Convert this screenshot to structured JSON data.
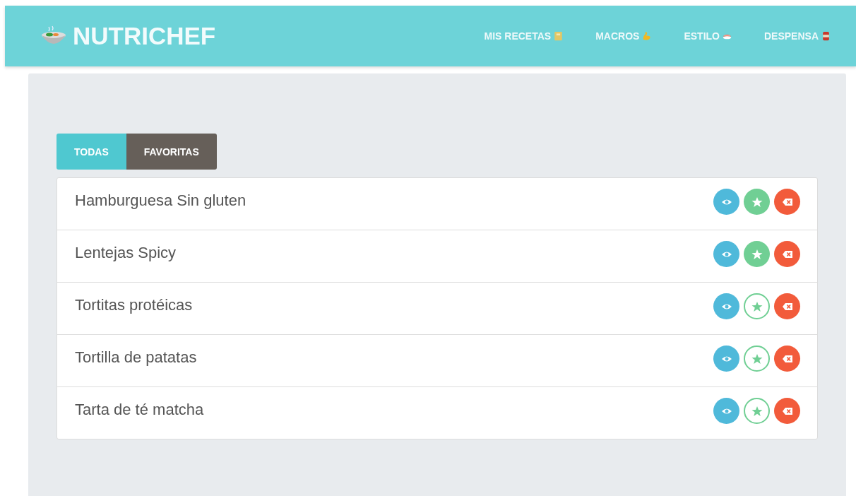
{
  "header": {
    "brand": "NUTRICHEF",
    "nav": [
      {
        "label": "MIS RECETAS",
        "kind": "book"
      },
      {
        "label": "MACROS",
        "kind": "arm"
      },
      {
        "label": "ESTILO",
        "kind": "sushi"
      },
      {
        "label": "DESPENSA",
        "kind": "can"
      }
    ]
  },
  "tabs": [
    {
      "label": "TODAS",
      "selected": true
    },
    {
      "label": "FAVORITAS",
      "selected": false
    }
  ],
  "recipes": [
    {
      "name": "Hamburguesa Sin gluten",
      "favorite": true
    },
    {
      "name": "Lentejas Spicy",
      "favorite": true
    },
    {
      "name": "Tortitas protéicas",
      "favorite": false
    },
    {
      "name": "Tortilla de patatas",
      "favorite": false
    },
    {
      "name": "Tarta de té matcha",
      "favorite": false
    }
  ]
}
